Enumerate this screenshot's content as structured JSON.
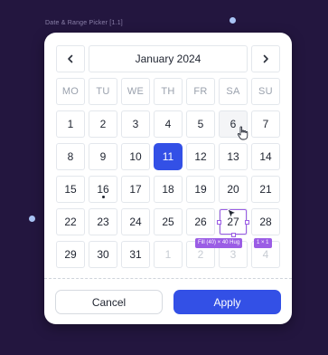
{
  "frame_label": "Date & Range Picker [1.1]",
  "calendar": {
    "month_label": "January 2024",
    "prev_icon": "chevron-left-icon",
    "next_icon": "chevron-right-icon",
    "weekdays": [
      "MO",
      "TU",
      "WE",
      "TH",
      "FR",
      "SA",
      "SU"
    ],
    "days": [
      [
        "1",
        "2",
        "3",
        "4",
        "5",
        "6",
        "7"
      ],
      [
        "8",
        "9",
        "10",
        "11",
        "12",
        "13",
        "14"
      ],
      [
        "15",
        "16",
        "17",
        "18",
        "19",
        "20",
        "21"
      ],
      [
        "22",
        "23",
        "24",
        "25",
        "26",
        "27",
        "28"
      ],
      [
        "29",
        "30",
        "31",
        "1",
        "2",
        "3",
        "4"
      ]
    ],
    "selected_day": "11",
    "today_day": "16",
    "hovered_day": "6"
  },
  "inspector": {
    "size_tag": "Fill (40) × 40 Hug",
    "ratio_tag": "1 × 1"
  },
  "actions": {
    "cancel_label": "Cancel",
    "apply_label": "Apply"
  },
  "colors": {
    "accent": "#3350e6",
    "selection_outline": "#9b5de5",
    "canvas_bg": "#23163f"
  }
}
